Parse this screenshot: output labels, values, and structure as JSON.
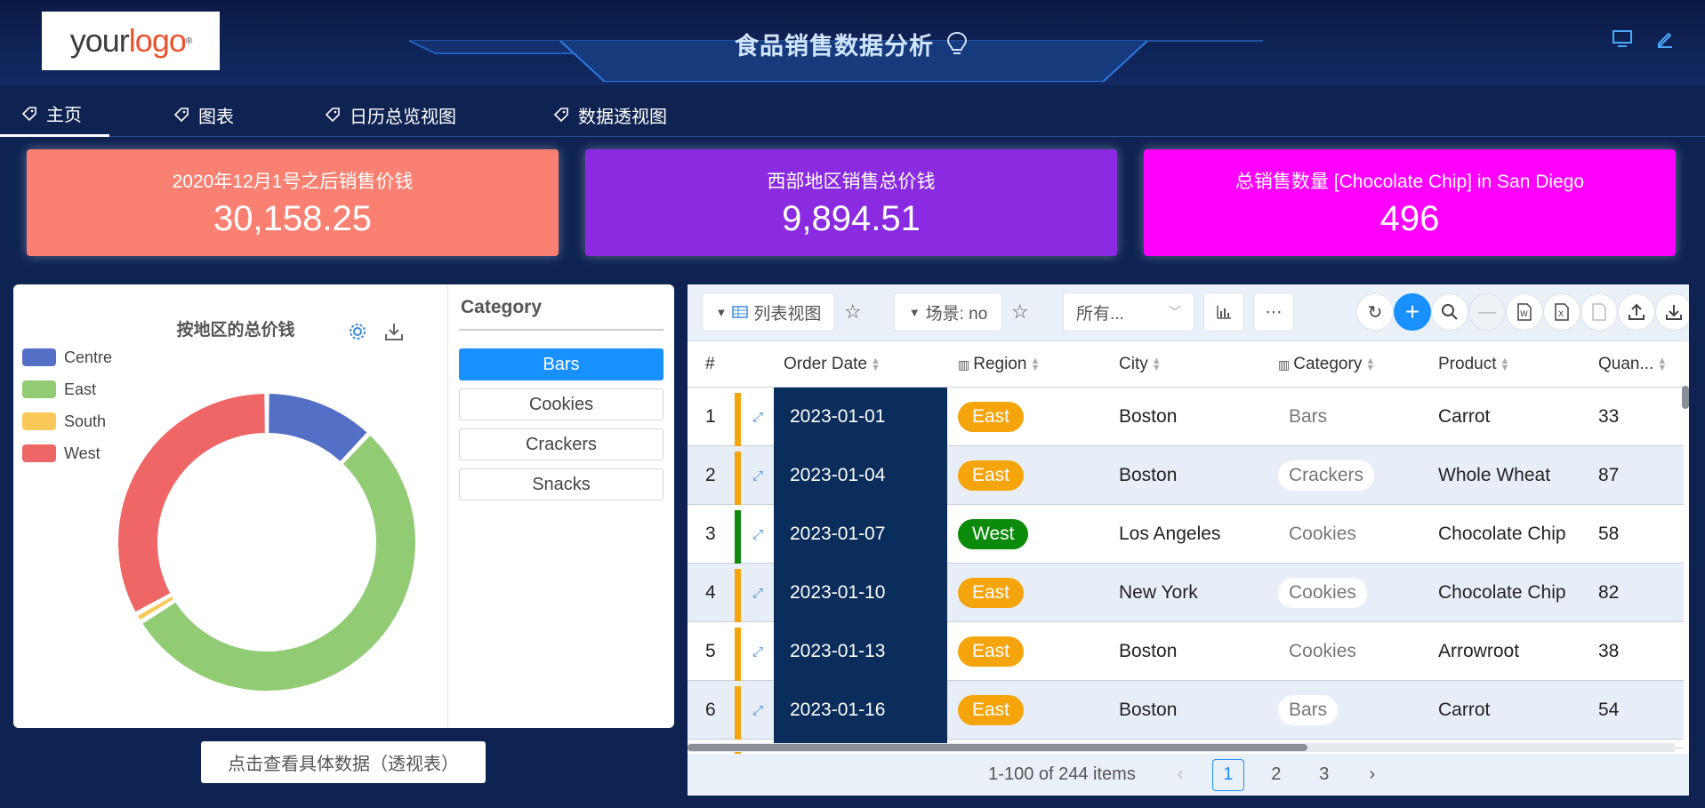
{
  "header": {
    "logo_text_1": "your",
    "logo_text_2": "logo",
    "logo_reg": "®",
    "title": "食品销售数据分析"
  },
  "tabs": [
    {
      "label": "主页",
      "active": true
    },
    {
      "label": "图表"
    },
    {
      "label": "日历总览视图"
    },
    {
      "label": "数据透视图"
    }
  ],
  "kpis": [
    {
      "label": "2020年12月1号之后销售价钱",
      "value": "30,158.25",
      "color": "#fa8072"
    },
    {
      "label": "西部地区销售总价钱",
      "value": "9,894.51",
      "color": "#8a2be2"
    },
    {
      "label": "总销售数量 [Chocolate Chip] in San Diego",
      "value": "496",
      "color": "#ff00ff"
    }
  ],
  "chart": {
    "title": "按地区的总价钱",
    "filter_title": "Category",
    "filter_options": [
      "Bars",
      "Cookies",
      "Crackers",
      "Snacks"
    ],
    "filter_selected": "Bars",
    "pivot_button": "点击查看具体数据（透视表）"
  },
  "chart_data": {
    "type": "pie",
    "title": "按地区的总价钱",
    "legend": "top-left",
    "series": [
      {
        "name": "Centre",
        "value": 12,
        "color": "#5470c6"
      },
      {
        "name": "East",
        "value": 54,
        "color": "#91cc75"
      },
      {
        "name": "South",
        "value": 1,
        "color": "#fac858"
      },
      {
        "name": "West",
        "value": 33,
        "color": "#ee6666"
      }
    ]
  },
  "toolbar": {
    "view_label": "列表视图",
    "scene_label": "场景: no",
    "filter_select": "所有..."
  },
  "grid": {
    "columns": [
      "#",
      "Order Date",
      "Region",
      "City",
      "Category",
      "Product",
      "Quan..."
    ],
    "rows": [
      {
        "n": "1",
        "date": "2023-01-01",
        "region": "East",
        "city": "Boston",
        "category": "Bars",
        "product": "Carrot",
        "qty": "33"
      },
      {
        "n": "2",
        "date": "2023-01-04",
        "region": "East",
        "city": "Boston",
        "category": "Crackers",
        "product": "Whole Wheat",
        "qty": "87"
      },
      {
        "n": "3",
        "date": "2023-01-07",
        "region": "West",
        "city": "Los Angeles",
        "category": "Cookies",
        "product": "Chocolate Chip",
        "qty": "58"
      },
      {
        "n": "4",
        "date": "2023-01-10",
        "region": "East",
        "city": "New York",
        "category": "Cookies",
        "product": "Chocolate Chip",
        "qty": "82"
      },
      {
        "n": "5",
        "date": "2023-01-13",
        "region": "East",
        "city": "Boston",
        "category": "Cookies",
        "product": "Arrowroot",
        "qty": "38"
      },
      {
        "n": "6",
        "date": "2023-01-16",
        "region": "East",
        "city": "Boston",
        "category": "Bars",
        "product": "Carrot",
        "qty": "54"
      }
    ],
    "region_colors": {
      "East": "#f5a40b",
      "West": "#0b8a0b"
    }
  },
  "pager": {
    "summary": "1-100 of 244 items",
    "pages": [
      "1",
      "2",
      "3"
    ],
    "current": "1"
  }
}
